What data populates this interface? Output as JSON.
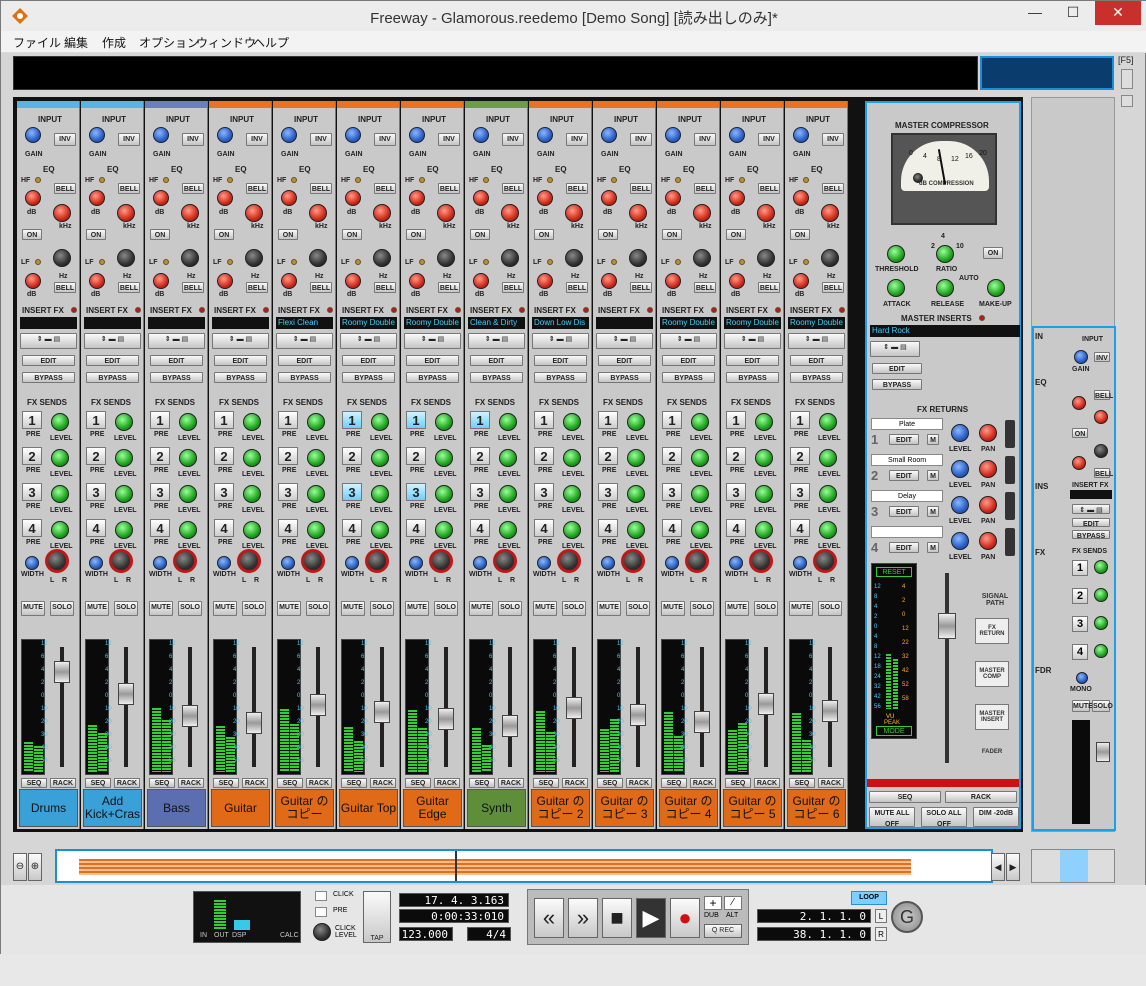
{
  "window": {
    "title": "Freeway - Glamorous.reedemo [Demo Song] [読み出しのみ]*",
    "minimize": "—",
    "maximize": "☐",
    "close": "✕"
  },
  "menu": [
    "ファイル",
    "編集",
    "作成",
    "オプション",
    "ウィンドウ",
    "ヘルプ"
  ],
  "minimap_shortcut": "[F5]",
  "labels": {
    "input": "INPUT",
    "inv": "INV",
    "gain": "GAIN",
    "eq": "EQ",
    "hf": "HF",
    "lf": "LF",
    "bell": "BELL",
    "db": "dB",
    "khz": "kHz",
    "hz": "Hz",
    "on": "ON",
    "insert_fx": "INSERT FX",
    "edit": "EDIT",
    "bypass": "BYPASS",
    "fx_sends": "FX SENDS",
    "pre": "PRE",
    "level": "LEVEL",
    "width": "WIDTH",
    "l": "L",
    "r": "R",
    "mute": "MUTE",
    "solo": "SOLO",
    "seq": "SEQ",
    "rack": "RACK"
  },
  "meter_scale": [
    "12",
    "6",
    "4",
    "2",
    "0",
    "10",
    "20",
    "30",
    "40",
    "56"
  ],
  "channels": [
    {
      "name": "Drums",
      "color": "#3aa0d8",
      "strip": "#55b5e8",
      "patch": "",
      "sends_on": [
        false,
        false,
        false,
        false
      ]
    },
    {
      "name": "Add Kick+Cras",
      "color": "#3aa0d8",
      "strip": "#55b5e8",
      "patch": "",
      "sends_on": [
        false,
        false,
        false,
        false
      ]
    },
    {
      "name": "Bass",
      "color": "#5a6eb0",
      "strip": "#6a7ec4",
      "patch": "",
      "sends_on": [
        false,
        false,
        false,
        false
      ]
    },
    {
      "name": "Guitar",
      "color": "#e06a18",
      "strip": "#e87422",
      "patch": "",
      "sends_on": [
        false,
        false,
        false,
        false
      ]
    },
    {
      "name": "Guitar のコピー",
      "color": "#e06a18",
      "strip": "#e87422",
      "patch": "Flexi Clean",
      "sends_on": [
        false,
        false,
        false,
        false
      ]
    },
    {
      "name": "Guitar Top",
      "color": "#e06a18",
      "strip": "#e87422",
      "patch": "Roomy Double",
      "sends_on": [
        true,
        false,
        true,
        false
      ]
    },
    {
      "name": "Guitar Edge",
      "color": "#e06a18",
      "strip": "#e87422",
      "patch": "Roomy Double",
      "sends_on": [
        true,
        false,
        true,
        false
      ]
    },
    {
      "name": "Synth",
      "color": "#5e8e3a",
      "strip": "#6e9e44",
      "patch": "Clean & Dirty",
      "sends_on": [
        true,
        false,
        false,
        false
      ]
    },
    {
      "name": "Guitar のコピー 2",
      "color": "#e06a18",
      "strip": "#e87422",
      "patch": "Down Low Dis",
      "sends_on": [
        false,
        false,
        false,
        false
      ]
    },
    {
      "name": "Guitar のコピー 3",
      "color": "#e06a18",
      "strip": "#e87422",
      "patch": "",
      "sends_on": [
        false,
        false,
        false,
        false
      ]
    },
    {
      "name": "Guitar のコピー 4",
      "color": "#e06a18",
      "strip": "#e87422",
      "patch": "Roomy Double",
      "sends_on": [
        false,
        false,
        false,
        false
      ]
    },
    {
      "name": "Guitar のコピー 5",
      "color": "#e06a18",
      "strip": "#e87422",
      "patch": "Roomy Double",
      "sends_on": [
        false,
        false,
        false,
        false
      ]
    },
    {
      "name": "Guitar のコピー 6",
      "color": "#e06a18",
      "strip": "#e87422",
      "patch": "Roomy Double",
      "sends_on": [
        false,
        false,
        false,
        false
      ]
    }
  ],
  "master": {
    "compressor_title": "MASTER COMPRESSOR",
    "vu_label": "dB COMPRESSION",
    "vu_scale": [
      "0",
      "4",
      "8",
      "12",
      "16",
      "20"
    ],
    "threshold": "THRESHOLD",
    "ratio": "RATIO",
    "ratio_marks": [
      "2",
      "4",
      "10"
    ],
    "attack": "ATTACK",
    "release": "RELEASE",
    "auto": "AUTO",
    "makeup": "MAKE-UP",
    "on": "ON",
    "inserts_title": "MASTER INSERTS",
    "insert_patch": "Hard Rock",
    "fx_returns": "FX RETURNS",
    "returns": [
      {
        "n": "1",
        "name": "Plate"
      },
      {
        "n": "2",
        "name": "Small Room"
      },
      {
        "n": "3",
        "name": "Delay"
      },
      {
        "n": "4",
        "name": ""
      }
    ],
    "m": "M",
    "pan": "PAN",
    "reset": "RESET",
    "vu": "VU",
    "peak": "PEAK",
    "mode": "MODE",
    "meter_left": [
      "12",
      "8",
      "4",
      "2",
      "0",
      "4",
      "8",
      "12",
      "18",
      "24",
      "32",
      "42",
      "56"
    ],
    "meter_right": [
      "4",
      "2",
      "0",
      "12",
      "22",
      "32",
      "42",
      "52",
      "58"
    ],
    "signal_path": "SIGNAL PATH",
    "path": [
      "FX RETURN",
      "MASTER COMP",
      "MASTER INSERT",
      "FADER"
    ],
    "mute_all": "MUTE ALL OFF",
    "solo_all": "SOLO ALL OFF",
    "dim": "DIM -20dB"
  },
  "right_panel": {
    "in": "IN",
    "eq": "EQ",
    "ins": "INS",
    "fx": "FX",
    "fdr": "FDR",
    "mono": "MONO",
    "fx_sends": "FX SENDS",
    "input": "INPUT",
    "gain": "GAIN",
    "inv": "INV",
    "bell": "BELL",
    "on": "ON",
    "insert_fx": "INSERT FX",
    "edit": "EDIT",
    "bypass": "BYPASS",
    "mute": "MUTE",
    "solo": "SOLO"
  },
  "transport": {
    "click": "CLICK",
    "pre": "PRE",
    "click_level": "CLICK LEVEL",
    "tap": "TAP",
    "in": "IN",
    "out": "OUT",
    "dsp": "DSP",
    "calc": "CALC",
    "position": "17. 4. 3.163",
    "time": "0:00:33:010",
    "tempo": "123.000",
    "signature": "4/4",
    "dub": "DUB",
    "alt": "ALT",
    "qrec": "Q REC",
    "loop": "LOOP",
    "left_loc": "2. 1. 1.   0",
    "right_loc": "38. 1. 1.   0",
    "l": "L",
    "r": "R",
    "rew": "«",
    "ffw": "»",
    "stop": "■",
    "play": "▶",
    "rec": "●"
  },
  "colors": {
    "accent": "#18a0e8",
    "orange": "#e06a18",
    "blue": "#3aa0d8",
    "green": "#5e8e3a"
  }
}
